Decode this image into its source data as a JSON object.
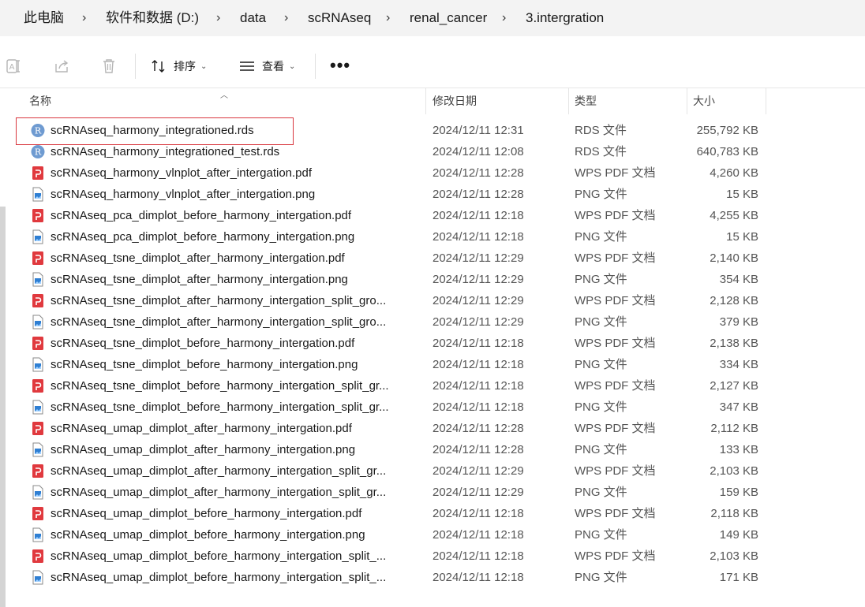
{
  "breadcrumb": [
    "此电脑",
    "软件和数据 (D:)",
    "data",
    "scRNAseq",
    "renal_cancer",
    "3.intergration"
  ],
  "breadcrumb_separator": "›",
  "toolbar": {
    "sort_label": "排序",
    "view_label": "查看",
    "more_label": "•••",
    "caret": "⌄"
  },
  "columns": {
    "name": "名称",
    "date": "修改日期",
    "type": "类型",
    "size": "大小"
  },
  "files": [
    {
      "name": "scRNAseq_harmony_integrationed.rds",
      "date": "2024/12/11 12:31",
      "type": "RDS 文件",
      "size": "255,792 KB",
      "icon": "rds-file-icon"
    },
    {
      "name": "scRNAseq_harmony_integrationed_test.rds",
      "date": "2024/12/11 12:08",
      "type": "RDS 文件",
      "size": "640,783 KB",
      "icon": "rds-file-icon"
    },
    {
      "name": "scRNAseq_harmony_vlnplot_after_intergation.pdf",
      "date": "2024/12/11 12:28",
      "type": "WPS PDF 文档",
      "size": "4,260 KB",
      "icon": "pdf-file-icon"
    },
    {
      "name": "scRNAseq_harmony_vlnplot_after_intergation.png",
      "date": "2024/12/11 12:28",
      "type": "PNG 文件",
      "size": "15 KB",
      "icon": "png-file-icon"
    },
    {
      "name": "scRNAseq_pca_dimplot_before_harmony_intergation.pdf",
      "date": "2024/12/11 12:18",
      "type": "WPS PDF 文档",
      "size": "4,255 KB",
      "icon": "pdf-file-icon"
    },
    {
      "name": "scRNAseq_pca_dimplot_before_harmony_intergation.png",
      "date": "2024/12/11 12:18",
      "type": "PNG 文件",
      "size": "15 KB",
      "icon": "png-file-icon"
    },
    {
      "name": "scRNAseq_tsne_dimplot_after_harmony_intergation.pdf",
      "date": "2024/12/11 12:29",
      "type": "WPS PDF 文档",
      "size": "2,140 KB",
      "icon": "pdf-file-icon"
    },
    {
      "name": "scRNAseq_tsne_dimplot_after_harmony_intergation.png",
      "date": "2024/12/11 12:29",
      "type": "PNG 文件",
      "size": "354 KB",
      "icon": "png-file-icon"
    },
    {
      "name": "scRNAseq_tsne_dimplot_after_harmony_intergation_split_gro...",
      "date": "2024/12/11 12:29",
      "type": "WPS PDF 文档",
      "size": "2,128 KB",
      "icon": "pdf-file-icon"
    },
    {
      "name": "scRNAseq_tsne_dimplot_after_harmony_intergation_split_gro...",
      "date": "2024/12/11 12:29",
      "type": "PNG 文件",
      "size": "379 KB",
      "icon": "png-file-icon"
    },
    {
      "name": "scRNAseq_tsne_dimplot_before_harmony_intergation.pdf",
      "date": "2024/12/11 12:18",
      "type": "WPS PDF 文档",
      "size": "2,138 KB",
      "icon": "pdf-file-icon"
    },
    {
      "name": "scRNAseq_tsne_dimplot_before_harmony_intergation.png",
      "date": "2024/12/11 12:18",
      "type": "PNG 文件",
      "size": "334 KB",
      "icon": "png-file-icon"
    },
    {
      "name": "scRNAseq_tsne_dimplot_before_harmony_intergation_split_gr...",
      "date": "2024/12/11 12:18",
      "type": "WPS PDF 文档",
      "size": "2,127 KB",
      "icon": "pdf-file-icon"
    },
    {
      "name": "scRNAseq_tsne_dimplot_before_harmony_intergation_split_gr...",
      "date": "2024/12/11 12:18",
      "type": "PNG 文件",
      "size": "347 KB",
      "icon": "png-file-icon"
    },
    {
      "name": "scRNAseq_umap_dimplot_after_harmony_intergation.pdf",
      "date": "2024/12/11 12:28",
      "type": "WPS PDF 文档",
      "size": "2,112 KB",
      "icon": "pdf-file-icon"
    },
    {
      "name": "scRNAseq_umap_dimplot_after_harmony_intergation.png",
      "date": "2024/12/11 12:28",
      "type": "PNG 文件",
      "size": "133 KB",
      "icon": "png-file-icon"
    },
    {
      "name": "scRNAseq_umap_dimplot_after_harmony_intergation_split_gr...",
      "date": "2024/12/11 12:29",
      "type": "WPS PDF 文档",
      "size": "2,103 KB",
      "icon": "pdf-file-icon"
    },
    {
      "name": "scRNAseq_umap_dimplot_after_harmony_intergation_split_gr...",
      "date": "2024/12/11 12:29",
      "type": "PNG 文件",
      "size": "159 KB",
      "icon": "png-file-icon"
    },
    {
      "name": "scRNAseq_umap_dimplot_before_harmony_intergation.pdf",
      "date": "2024/12/11 12:18",
      "type": "WPS PDF 文档",
      "size": "2,118 KB",
      "icon": "pdf-file-icon"
    },
    {
      "name": "scRNAseq_umap_dimplot_before_harmony_intergation.png",
      "date": "2024/12/11 12:18",
      "type": "PNG 文件",
      "size": "149 KB",
      "icon": "png-file-icon"
    },
    {
      "name": "scRNAseq_umap_dimplot_before_harmony_intergation_split_...",
      "date": "2024/12/11 12:18",
      "type": "WPS PDF 文档",
      "size": "2,103 KB",
      "icon": "pdf-file-icon"
    },
    {
      "name": "scRNAseq_umap_dimplot_before_harmony_intergation_split_...",
      "date": "2024/12/11 12:18",
      "type": "PNG 文件",
      "size": "171 KB",
      "icon": "png-file-icon"
    }
  ],
  "highlighted_file_index": 0,
  "colors": {
    "highlight_border": "#d9363e",
    "rds_icon": "#6f9bd1",
    "pdf_icon": "#e0393e",
    "png_icon": "#2f7fd3"
  }
}
